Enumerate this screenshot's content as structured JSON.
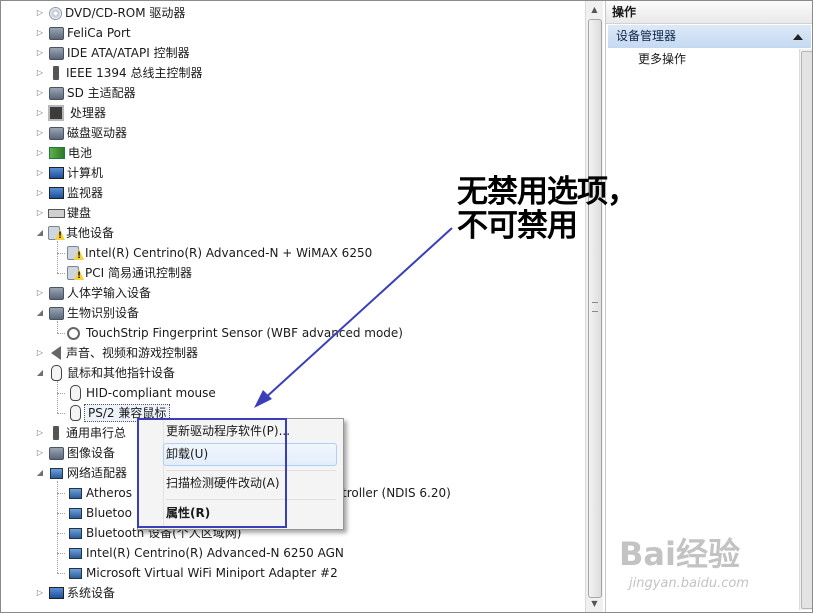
{
  "tree": {
    "items": [
      {
        "label": "DVD/CD-ROM 驱动器",
        "icon": "dvd-drive-icon",
        "level": 0,
        "expanded": false
      },
      {
        "label": "FeliCa Port",
        "icon": "felica-port-icon",
        "level": 0,
        "expanded": false
      },
      {
        "label": "IDE ATA/ATAPI 控制器",
        "icon": "ide-controller-icon",
        "level": 0,
        "expanded": false
      },
      {
        "label": "IEEE 1394 总线主控制器",
        "icon": "ieee1394-icon",
        "level": 0,
        "expanded": false
      },
      {
        "label": "SD 主适配器",
        "icon": "sd-adapter-icon",
        "level": 0,
        "expanded": false
      },
      {
        "label": "处理器",
        "icon": "processor-icon",
        "level": 0,
        "expanded": false
      },
      {
        "label": "磁盘驱动器",
        "icon": "disk-drive-icon",
        "level": 0,
        "expanded": false
      },
      {
        "label": "电池",
        "icon": "battery-icon",
        "level": 0,
        "expanded": false
      },
      {
        "label": "计算机",
        "icon": "computer-icon",
        "level": 0,
        "expanded": false
      },
      {
        "label": "监视器",
        "icon": "monitor-icon",
        "level": 0,
        "expanded": false
      },
      {
        "label": "键盘",
        "icon": "keyboard-icon",
        "level": 0,
        "expanded": false
      },
      {
        "label": "其他设备",
        "icon": "other-devices-warning-icon",
        "level": 0,
        "expanded": true
      },
      {
        "label": "Intel(R) Centrino(R) Advanced-N + WiMAX 6250",
        "icon": "warning-device-icon",
        "level": 1
      },
      {
        "label": "PCI 简易通讯控制器",
        "icon": "warning-device-icon",
        "level": 1
      },
      {
        "label": "人体学输入设备",
        "icon": "hid-icon",
        "level": 0,
        "expanded": false
      },
      {
        "label": "生物识别设备",
        "icon": "biometric-icon",
        "level": 0,
        "expanded": true
      },
      {
        "label": "TouchStrip Fingerprint Sensor (WBF advanced mode)",
        "icon": "fingerprint-icon",
        "level": 1
      },
      {
        "label": "声音、视频和游戏控制器",
        "icon": "sound-icon",
        "level": 0,
        "expanded": false
      },
      {
        "label": "鼠标和其他指针设备",
        "icon": "mouse-icon",
        "level": 0,
        "expanded": true
      },
      {
        "label": "HID-compliant mouse",
        "icon": "mouse-icon",
        "level": 1
      },
      {
        "label": "PS/2 兼容鼠标",
        "icon": "mouse-icon",
        "level": 1,
        "selected": true
      },
      {
        "label": "通用串行总线控制器",
        "icon": "usb-icon",
        "level": 0,
        "expanded": false,
        "obscured_label": "通用串行总"
      },
      {
        "label": "图像设备",
        "icon": "imaging-icon",
        "level": 0,
        "expanded": false
      },
      {
        "label": "网络适配器",
        "icon": "network-adapter-icon",
        "level": 0,
        "expanded": true
      },
      {
        "label": "Atheros",
        "icon": "network-adapter-icon",
        "level": 1,
        "tail": "troller (NDIS 6.20)"
      },
      {
        "label": "Bluetoo",
        "icon": "network-adapter-icon",
        "level": 1
      },
      {
        "label": "Bluetooth 设备(个人区域网)",
        "icon": "network-adapter-icon",
        "level": 1
      },
      {
        "label": "Intel(R) Centrino(R) Advanced-N 6250 AGN",
        "icon": "network-adapter-icon",
        "level": 1
      },
      {
        "label": "Microsoft Virtual WiFi Miniport Adapter #2",
        "icon": "network-adapter-icon",
        "level": 1
      },
      {
        "label": "系统设备",
        "icon": "system-devices-icon",
        "level": 0,
        "expanded": false
      }
    ]
  },
  "actions": {
    "header": "操作",
    "section": "设备管理器",
    "item": "更多操作"
  },
  "context_menu": {
    "items": [
      {
        "label": "更新驱动程序软件(P)...",
        "bold": false,
        "hover": false
      },
      {
        "label": "卸载(U)",
        "bold": false,
        "hover": true
      },
      {
        "label": "扫描检测硬件改动(A)",
        "bold": false,
        "hover": false
      },
      {
        "label": "属性(R)",
        "bold": true,
        "hover": false
      }
    ]
  },
  "annotation": {
    "line1": "无禁用选项，",
    "line2": "不可禁用",
    "box_color": "#3b3fb7",
    "arrow_color": "#3b3fb7"
  },
  "watermark": {
    "logo": "Bai经验",
    "url": "jingyan.baidu.com"
  }
}
